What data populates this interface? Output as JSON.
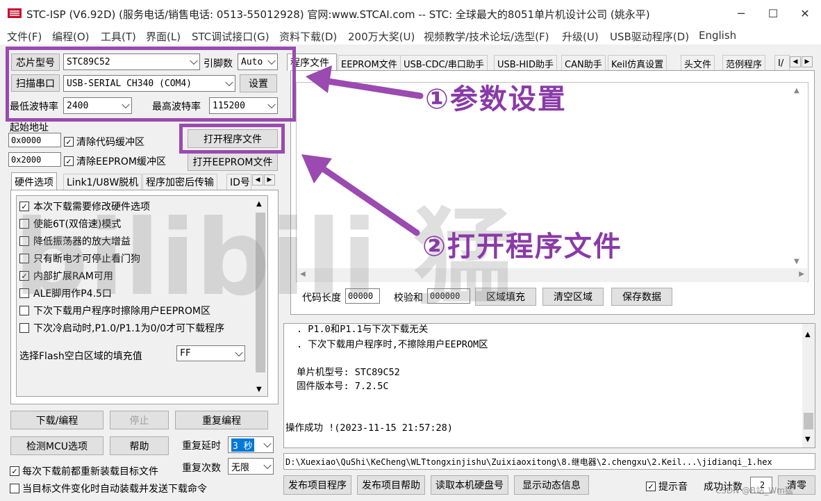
{
  "window": {
    "title": "STC-ISP (V6.92D) (服务电话/销售电话: 0513-55012928) 官网:www.STCAI.com  -- STC: 全球最大的8051单片机设计公司 (姚永平)",
    "min_label": "─",
    "max_label": "☐",
    "close_label": "✕"
  },
  "menu": [
    "文件(F)",
    "编程(O)",
    "工具(T)",
    "界面(L)",
    "STC调试接口(G)",
    "资料下载(D)",
    "200万大奖(U)",
    "视频教学/技术论坛/选型(F)",
    "升级(U)",
    "USB驱动程序(D)",
    "English"
  ],
  "config": {
    "chip_type_btn": "芯片型号",
    "chip_type_value": "STC89C52",
    "pin_label": "引脚数",
    "pin_value": "Auto",
    "scan_port_btn": "扫描串口",
    "port_value": "USB-SERIAL CH340 (COM4)",
    "settings_btn": "设置",
    "min_baud_label": "最低波特率",
    "min_baud_value": "2400",
    "max_baud_label": "最高波特率",
    "max_baud_value": "115200"
  },
  "start_address": {
    "label": "起始地址",
    "code_addr": "0x0000",
    "clear_code_label": "清除代码缓冲区",
    "open_program_btn": "打开程序文件",
    "eeprom_addr": "0x2000",
    "clear_eeprom_label": "清除EEPROM缓冲区",
    "open_eeprom_btn": "打开EEPROM文件"
  },
  "left_tabs": [
    "硬件选项",
    "Link1/U8W脱机",
    "程序加密后传输",
    "ID号"
  ],
  "hw_options": [
    {
      "label": "本次下载需要修改硬件选项",
      "checked": true
    },
    {
      "label": "使能6T(双倍速)模式",
      "checked": false
    },
    {
      "label": "降低振荡器的放大增益",
      "checked": false
    },
    {
      "label": "只有断电才可停止看门狗",
      "checked": false
    },
    {
      "label": "内部扩展RAM可用",
      "checked": true
    },
    {
      "label": "ALE脚用作P4.5口",
      "checked": false
    },
    {
      "label": "下次下载用户程序时擦除用户EEPROM区",
      "checked": false
    },
    {
      "label": "下次冷启动时,P1.0/P1.1为0/0才可下载程序",
      "checked": false
    }
  ],
  "flash_fill": {
    "label": "选择Flash空白区域的填充值",
    "value": "FF"
  },
  "actions": {
    "download_btn": "下载/编程",
    "stop_btn": "停止",
    "reprogram_btn": "重复编程",
    "detect_btn": "检测MCU选项",
    "help_btn": "帮助",
    "repeat_delay_label": "重复延时",
    "repeat_delay_value": "3 秒",
    "repeat_count_label": "重复次数",
    "repeat_count_value": "无限",
    "reload_label": "每次下载前都重新装载目标文件",
    "reload_checked": true,
    "auto_label": "当目标文件变化时自动装载并发送下载命令",
    "auto_checked": false
  },
  "right_tabs": [
    "程序文件",
    "EEPROM文件",
    "USB-CDC/串口助手",
    "USB-HID助手",
    "CAN助手",
    "Keil仿真设置",
    "头文件",
    "范例程序",
    "I/"
  ],
  "code_panel": {
    "code_len_label": "代码长度",
    "code_len_value": "00000",
    "checksum_label": "校验和",
    "checksum_value": "000000",
    "fill_btn": "区域填充",
    "clear_btn": "清空区域",
    "save_btn": "保存数据"
  },
  "log": {
    "lines": [
      ". P1.0和P1.1与下次下载无关",
      ". 下次下载用户程序时,不擦除用户EEPROM区",
      "",
      "单片机型号: STC89C52",
      "固件版本号: 7.2.5C",
      "",
      "",
      "操作成功 !(2023-11-15 21:57:28)"
    ]
  },
  "file_path": "D:\\Xuexiao\\QuShi\\KeCheng\\WLTtongxinjishu\\Zuixiaoxitong\\8.继电器\\2.chengxu\\2.Keil...\\jidianqi_1.hex",
  "bottom": {
    "publish_btn": "发布项目程序",
    "publish_help_btn": "发布项目帮助",
    "read_disk_btn": "读取本机硬盘号",
    "show_dynamic_btn": "显示动态信息",
    "sound_label": "提示音",
    "sound_checked": true,
    "success_count_label": "成功计数",
    "success_count_value": "2",
    "clear_btn": "清零"
  },
  "annotations": {
    "step1": "①参数设置",
    "step2": "②打开程序文件"
  },
  "watermark_text": "bilibili 猛",
  "csdn_watermark": "CSDN @B站_Wm猛",
  "colors": {
    "annotation": "#9a4ab0"
  }
}
